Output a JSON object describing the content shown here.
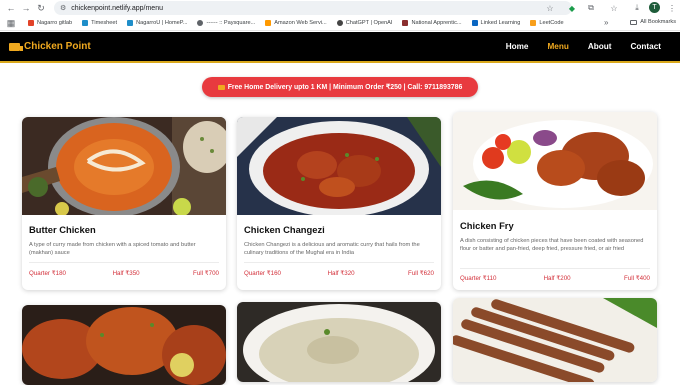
{
  "browser": {
    "url": "chickenpoint.netlify.app/menu",
    "bookmarks": [
      {
        "label": "Nagarro gitlab",
        "color": "#e24329"
      },
      {
        "label": "Timesheet",
        "color": "#1f8ec9"
      },
      {
        "label": "NagarroU | HomeP...",
        "color": "#1f8ec9"
      },
      {
        "label": "------ :: Paysquare...",
        "color": "#5f6368"
      },
      {
        "label": "Amazon Web Servi...",
        "color": "#ff9900"
      },
      {
        "label": "ChatGPT | OpenAI",
        "color": "#444444"
      },
      {
        "label": "National Apprentic...",
        "color": "#8a2e2e"
      },
      {
        "label": "Linked Learning",
        "color": "#0a66c2"
      },
      {
        "label": "LeetCode",
        "color": "#f89f1b"
      }
    ],
    "more_bookmarks": "»",
    "all_bookmarks": "All Bookmarks",
    "avatar_letter": "T"
  },
  "site": {
    "brand": "Chicken Point",
    "nav": [
      "Home",
      "Menu",
      "About",
      "Contact"
    ],
    "active_nav": "Menu",
    "accent": "#f0a91f",
    "promo": "Free Home Delivery upto 1 KM | Minimum Order ₹250 | Call: 9711893786"
  },
  "menu": [
    {
      "name": "Butter Chicken",
      "description": "A type of curry made from chicken with a spiced tomato and butter (makhan) sauce",
      "quarter": "Quarter ₹180",
      "half": "Half ₹350",
      "full": "Full ₹700"
    },
    {
      "name": "Chicken Changezi",
      "description": "Chicken Changezi is a delicious and aromatic curry that hails from the culinary traditions of the Mughal era in India",
      "quarter": "Quarter ₹160",
      "half": "Half ₹320",
      "full": "Full ₹620"
    },
    {
      "name": "Chicken Fry",
      "description": "A dish consisting of chicken pieces that have been coated with seasoned flour or batter and pan-fried, deep fried, pressure fried, or air fried",
      "quarter": "Quarter ₹110",
      "half": "Half ₹200",
      "full": "Full ₹400"
    }
  ]
}
